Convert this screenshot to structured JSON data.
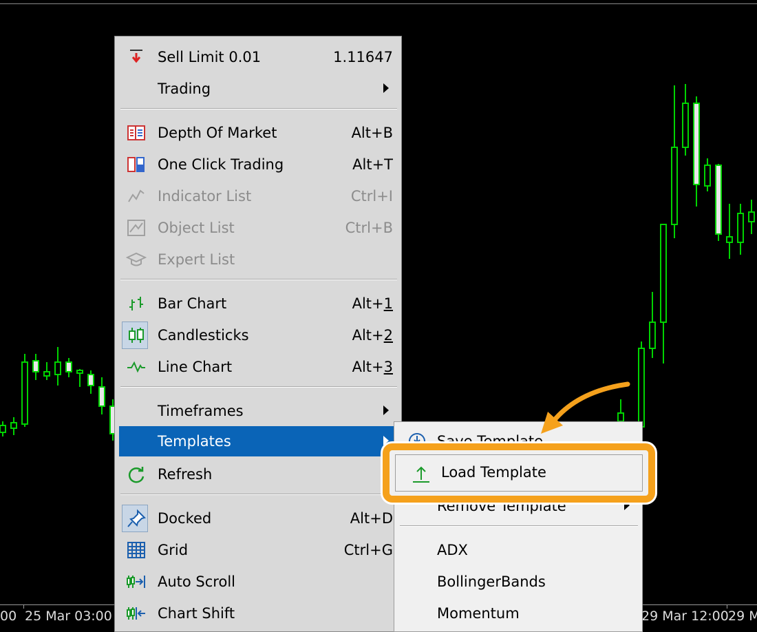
{
  "chart": {
    "background": "#000000",
    "candle_color": "#00d400",
    "x_axis_labels": [
      "00",
      "25 Mar 03:00",
      "29 Mar 12:00",
      "29 M"
    ]
  },
  "main_menu": {
    "items": [
      {
        "label": "Sell Limit 0.01",
        "shortcut": "1.11647",
        "icon": "sell-limit-icon"
      },
      {
        "label": "Trading",
        "submenu": true
      },
      {
        "label": "Depth Of Market",
        "shortcut": "Alt+B",
        "icon": "depth-of-market-icon"
      },
      {
        "label": "One Click Trading",
        "shortcut": "Alt+T",
        "icon": "one-click-trading-icon"
      },
      {
        "label": "Indicator List",
        "shortcut": "Ctrl+I",
        "icon": "indicator-list-icon",
        "disabled": true
      },
      {
        "label": "Object List",
        "shortcut": "Ctrl+B",
        "icon": "object-list-icon",
        "disabled": true
      },
      {
        "label": "Expert List",
        "icon": "expert-list-icon",
        "disabled": true
      },
      {
        "label": "Bar Chart",
        "shortcut_prefix": "Alt+",
        "shortcut_key": "1",
        "icon": "bar-chart-icon"
      },
      {
        "label": "Candlesticks",
        "shortcut_prefix": "Alt+",
        "shortcut_key": "2",
        "icon": "candlesticks-icon",
        "checked": true
      },
      {
        "label": "Line Chart",
        "shortcut_prefix": "Alt+",
        "shortcut_key": "3",
        "icon": "line-chart-icon"
      },
      {
        "label": "Timeframes",
        "submenu": true
      },
      {
        "label": "Templates",
        "submenu": true,
        "highlighted": true
      },
      {
        "label": "Refresh",
        "icon": "refresh-icon"
      },
      {
        "label": "Docked",
        "shortcut": "Alt+D",
        "icon": "pin-icon",
        "checked": true
      },
      {
        "label": "Grid",
        "shortcut": "Ctrl+G",
        "icon": "grid-icon"
      },
      {
        "label": "Auto Scroll",
        "icon": "auto-scroll-icon"
      },
      {
        "label": "Chart Shift",
        "icon": "chart-shift-icon"
      }
    ]
  },
  "templates_submenu": {
    "items": [
      {
        "label": "Save Template",
        "icon": "save-template-icon"
      },
      {
        "label": "Load Template",
        "icon": "load-template-icon"
      },
      {
        "label": "Remove Template",
        "submenu": true
      },
      {
        "label": "ADX"
      },
      {
        "label": "BollingerBands"
      },
      {
        "label": "Momentum"
      }
    ]
  },
  "callout": {
    "color": "#f5a11c"
  }
}
